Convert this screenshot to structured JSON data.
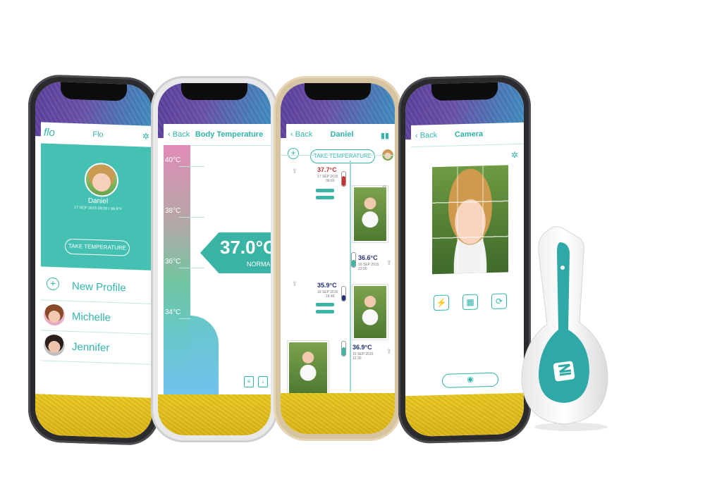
{
  "colors": {
    "teal": "#2fb5a9",
    "red": "#c83232",
    "navy": "#23307a"
  },
  "phone1": {
    "logo": "flo",
    "title": "Flo",
    "profile_name": "Daniel",
    "profile_meta": "17 SEP 2015 09:00 / 99.9°F",
    "take_button": "TAKE TEMPERATURE",
    "list": [
      {
        "label": "New Profile",
        "icon": "plus-circle-icon"
      },
      {
        "label": "Michelle",
        "icon": "avatar"
      },
      {
        "label": "Jennifer",
        "icon": "avatar"
      }
    ]
  },
  "phone2": {
    "back": "Back",
    "title": "Body Temperature",
    "ticks": [
      "40°C",
      "38°C",
      "36°C",
      "34°C"
    ],
    "reading": "37.0°C",
    "status": "NORMAL"
  },
  "phone3": {
    "back": "Back",
    "title": "Daniel",
    "take_button": "TAKE TEMPERATURE",
    "entries": [
      {
        "temp": "37.7°C",
        "date": "17 SEP 2015",
        "time": "09:00"
      },
      {
        "temp": "36.6°C",
        "date": "16 SEP 2015",
        "time": "23:00"
      },
      {
        "temp": "35.9°C",
        "date": "16 SEP 2015",
        "time": "18:45"
      },
      {
        "temp": "36.9°C",
        "date": "15 SEP 2015",
        "time": "12:30"
      }
    ]
  },
  "phone4": {
    "back": "Back",
    "title": "Camera"
  }
}
